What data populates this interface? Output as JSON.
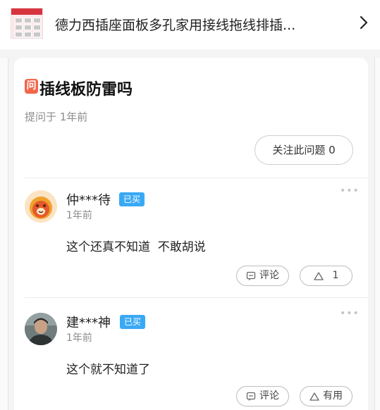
{
  "product": {
    "title": "德力西插座面板多孔家用接线拖线排插...",
    "thumb_icon": "product-thumbnail",
    "arrow_icon": "chevron-right-icon"
  },
  "question": {
    "badge": "问",
    "title": "插线板防雷吗",
    "meta": "提问于 1年前",
    "follow_label": "关注此问题 0"
  },
  "answers": [
    {
      "username": "仲***待",
      "badge": "已买",
      "time": "1年前",
      "content": "这个还真不知道  不敢胡说",
      "comment_label": "评论",
      "like_label": "1",
      "more": "•••"
    },
    {
      "username": "建***神",
      "badge": "已买",
      "time": "1年前",
      "content": "这个就不知道了",
      "comment_label": "评论",
      "like_label": "有用",
      "more": "•••"
    }
  ],
  "colors": {
    "accent_badge": "#3aa9f4",
    "question_icon": "#f2664b"
  }
}
